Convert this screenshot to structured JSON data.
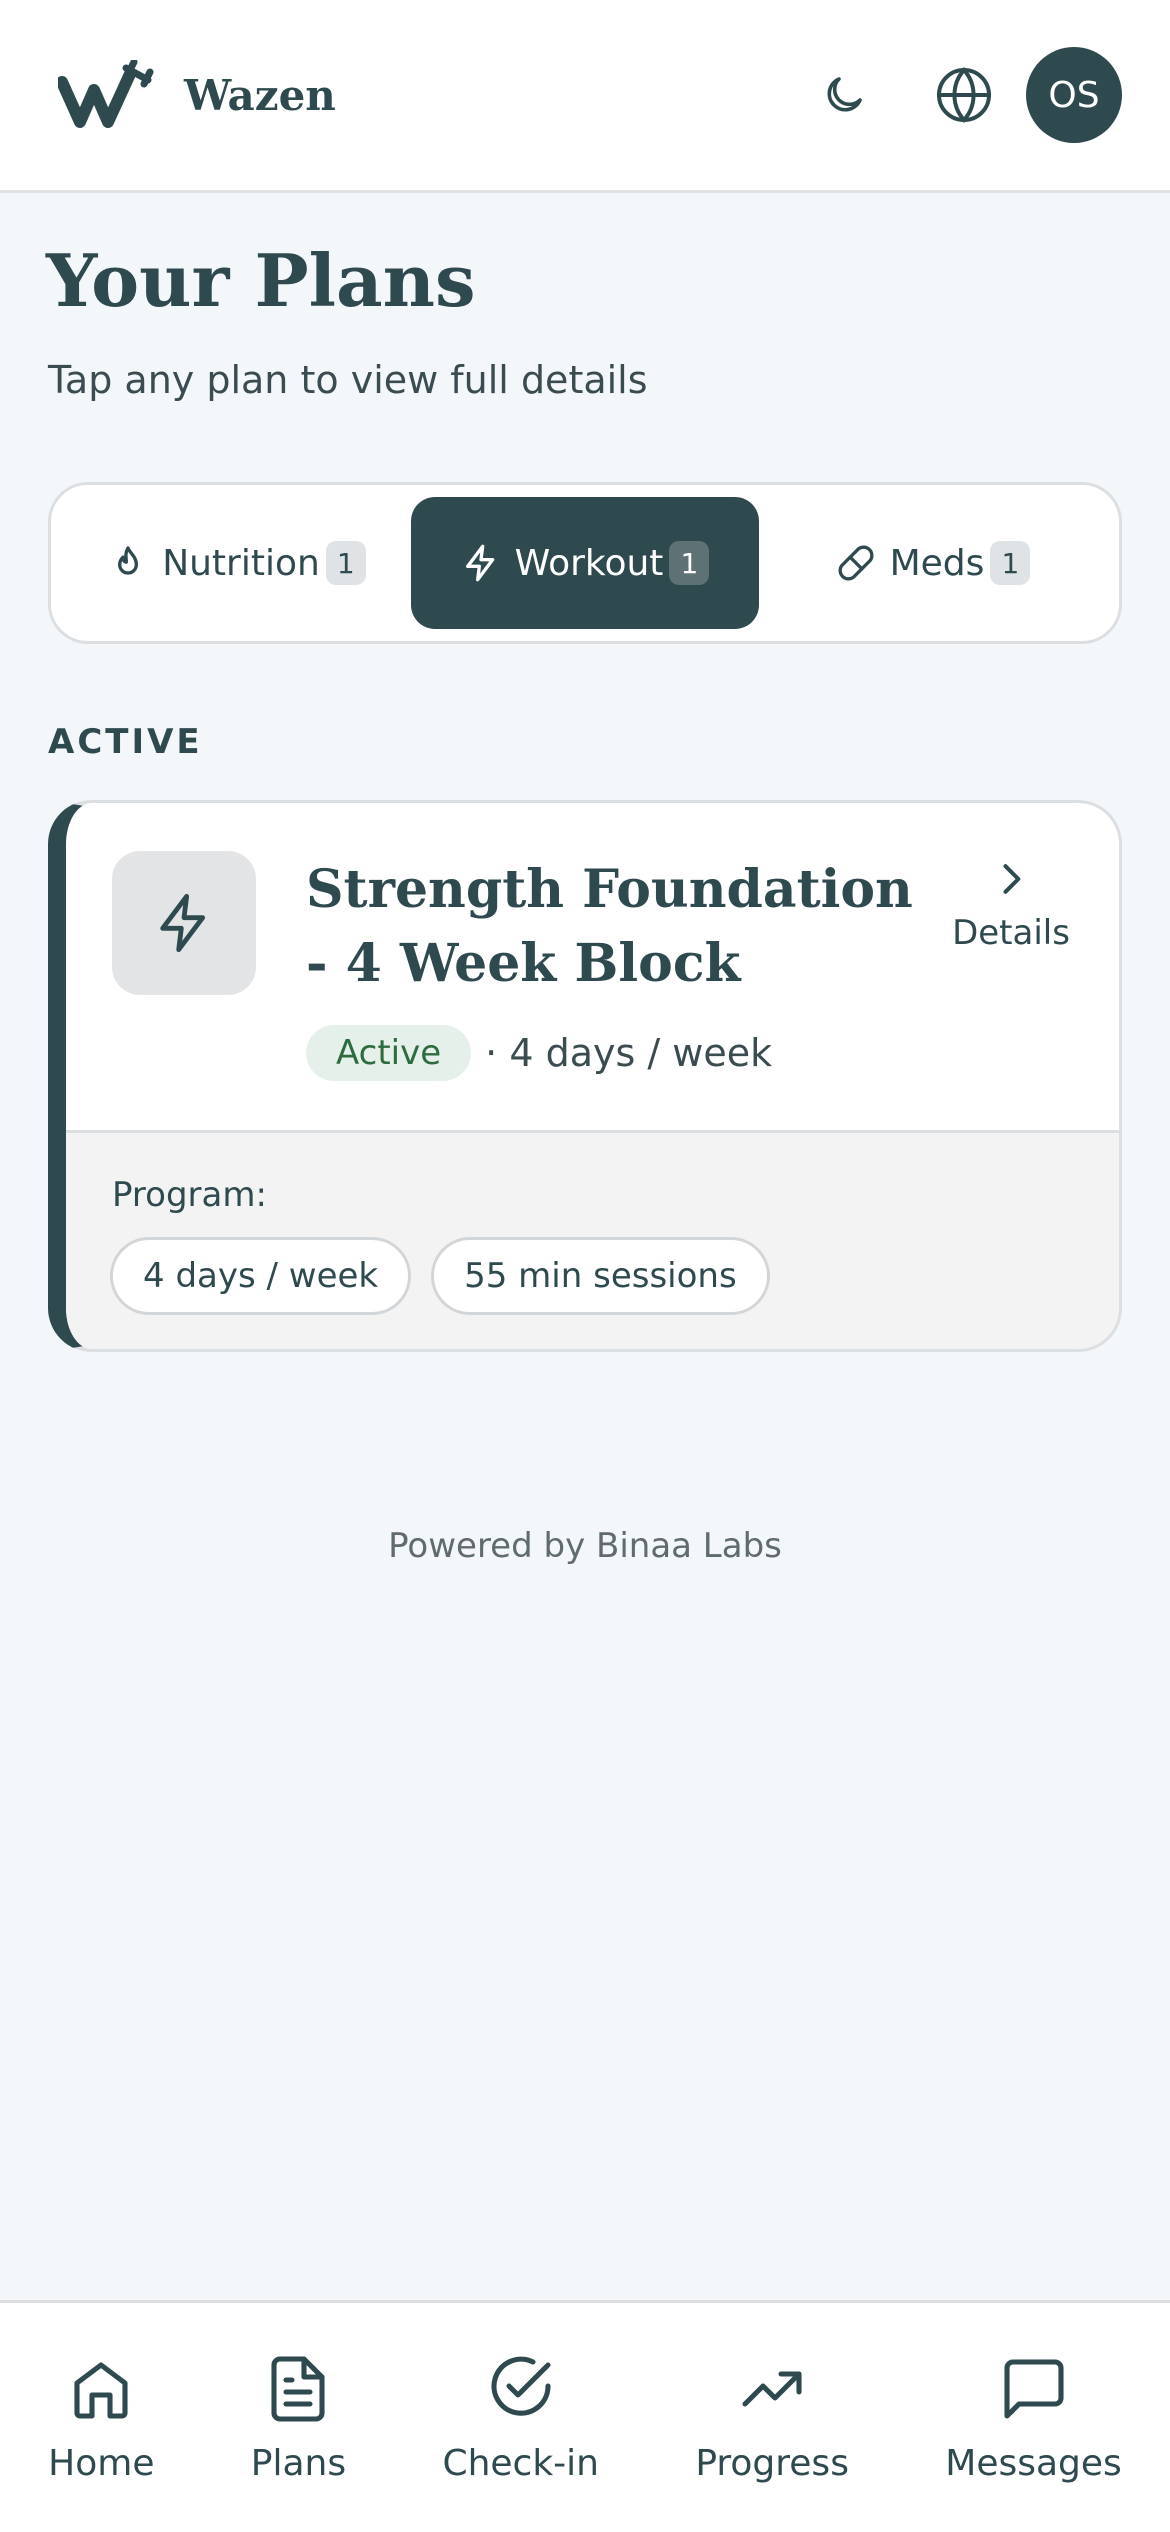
{
  "header": {
    "brand": "Wazen",
    "avatar_initials": "OS",
    "icons": [
      "logo-w-icon",
      "moon-icon",
      "globe-icon"
    ]
  },
  "page": {
    "title": "Your Plans",
    "subtitle": "Tap any plan to view full details"
  },
  "tabs": [
    {
      "label": "Nutrition",
      "count": "1",
      "icon": "flame-icon",
      "active": false
    },
    {
      "label": "Workout",
      "count": "1",
      "icon": "lightning-icon",
      "active": true
    },
    {
      "label": "Meds",
      "count": "1",
      "icon": "pill-icon",
      "active": false
    }
  ],
  "section_label": "ACTIVE",
  "plan": {
    "title": "Strength Foundation - 4 Week Block",
    "status": "Active",
    "frequency": "· 4 days / week",
    "details_label": "Details",
    "program_label": "Program:",
    "chips": [
      "4 days / week",
      "55 min sessions"
    ]
  },
  "footer": {
    "powered_by": "Powered by Binaa Labs"
  },
  "nav": [
    {
      "label": "Home",
      "icon": "home-icon"
    },
    {
      "label": "Plans",
      "icon": "document-icon"
    },
    {
      "label": "Check-in",
      "icon": "check-circle-icon"
    },
    {
      "label": "Progress",
      "icon": "trending-up-icon"
    },
    {
      "label": "Messages",
      "icon": "message-icon"
    }
  ],
  "colors": {
    "primary": "#2f4a4f",
    "background": "#f4f7fa",
    "status_bg": "#e6f0ea",
    "status_text": "#2e6b3f"
  }
}
